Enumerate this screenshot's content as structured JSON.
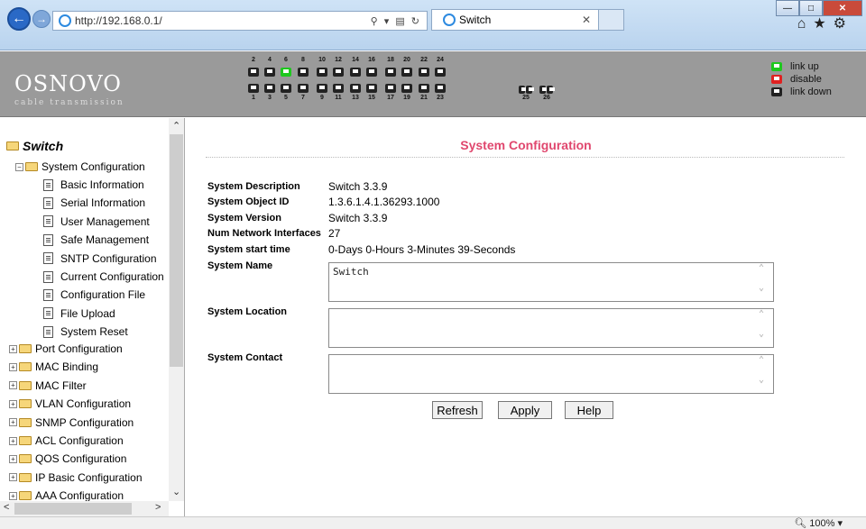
{
  "browser": {
    "url": "http://192.168.0.1/",
    "tab_title": "Switch",
    "zoom": "100%"
  },
  "header": {
    "logo": "OSNOVO",
    "logo_sub": "cable transmission",
    "ports_top": [
      "2",
      "4",
      "6",
      "8",
      "10",
      "12",
      "14",
      "16",
      "18",
      "20",
      "22",
      "24"
    ],
    "ports_bottom": [
      "1",
      "3",
      "5",
      "7",
      "9",
      "11",
      "13",
      "15",
      "17",
      "19",
      "21",
      "23",
      "25",
      "26"
    ],
    "port_status_up": [
      "6"
    ],
    "legend": {
      "up": "link up",
      "disable": "disable",
      "down": "link down"
    },
    "colors": {
      "up": "#1ec81e",
      "disable": "#e02222",
      "down": "#222222"
    }
  },
  "sidebar": {
    "root": "Switch",
    "open_folder": "System Configuration",
    "children": [
      "Basic Information",
      "Serial Information",
      "User Management",
      "Safe Management",
      "SNTP Configuration",
      "Current Configuration",
      "Configuration File",
      "File Upload",
      "System Reset"
    ],
    "folders": [
      "Port Configuration",
      "MAC Binding",
      "MAC Filter",
      "VLAN Configuration",
      "SNMP Configuration",
      "ACL Configuration",
      "QOS Configuration",
      "IP Basic Configuration",
      "AAA Configuration"
    ]
  },
  "main": {
    "title": "System Configuration",
    "title_color": "#e0476e",
    "fields": [
      {
        "label": "System Description",
        "value": "Switch 3.3.9"
      },
      {
        "label": "System Object ID",
        "value": "1.3.6.1.4.1.36293.1000"
      },
      {
        "label": "System Version",
        "value": "Switch 3.3.9"
      },
      {
        "label": "Num Network Interfaces",
        "value": "27"
      },
      {
        "label": "System start time",
        "value": "0-Days 0-Hours 3-Minutes 39-Seconds"
      }
    ],
    "system_name_label": "System Name",
    "system_name_value": "Switch",
    "system_location_label": "System Location",
    "system_location_value": "",
    "system_contact_label": "System Contact",
    "system_contact_value": "",
    "buttons": {
      "refresh": "Refresh",
      "apply": "Apply",
      "help": "Help"
    }
  }
}
